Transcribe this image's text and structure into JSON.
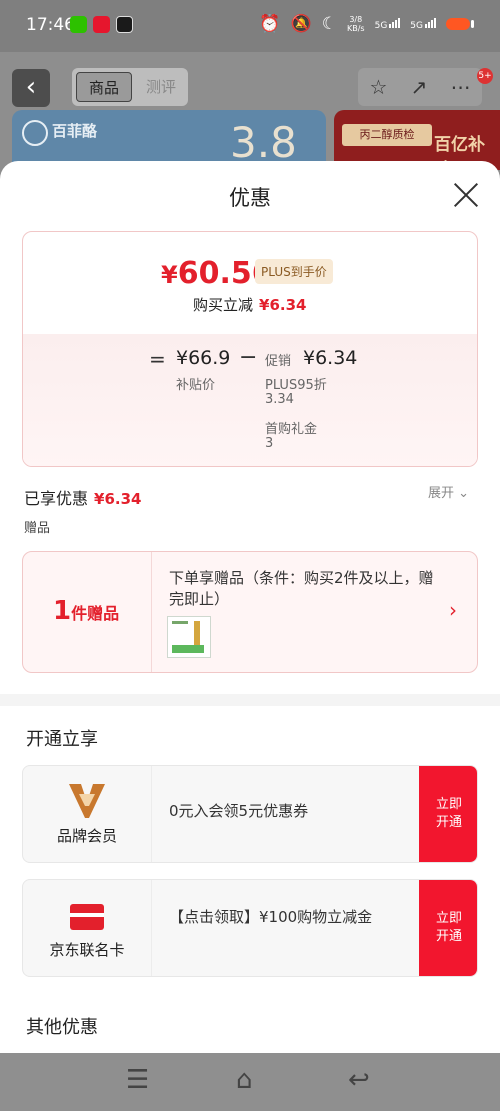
{
  "status_bar": {
    "time": "17:46",
    "net_speed_top": "3/8",
    "net_speed_bottom": "KB/s",
    "sig1": "5G",
    "sig2": "5G"
  },
  "header": {
    "tab_active": "商品",
    "tab_inactive": "测评",
    "badge": "5+"
  },
  "banners": {
    "left_brand": "百菲酪",
    "left_big": "3.8",
    "right_tag": "丙二醇质检",
    "right_text": "百亿补贴"
  },
  "sheet": {
    "title": "优惠",
    "price": {
      "symbol": "¥",
      "amount": "60.56",
      "plus_tag": "PLUS到手价",
      "buy_label": "购买立减",
      "buy_amount": "¥6.34"
    },
    "breakdown": {
      "equals": "=",
      "subsidy_price": "¥66.9",
      "subsidy_label": "补贴价",
      "minus": "−",
      "promo_label": "促销",
      "promo_amount": "¥6.34",
      "plus95_label": "PLUS95折",
      "plus95_value": "3.34",
      "first_gift_label": "首购礼金",
      "first_gift_value": "3"
    },
    "enjoyed_label": "已享优惠",
    "enjoyed_amount": "¥6.34",
    "expand_label": "展开",
    "gift_section_label": "赠品",
    "gift": {
      "count": "1",
      "count_suffix": "件赠品",
      "desc": "下单享赠品（条件：购买2件及以上，赠完即止）"
    },
    "open_section_title": "开通立享",
    "members": [
      {
        "title": "品牌会员",
        "desc": "0元入会领5元优惠券",
        "button": "立即开通"
      },
      {
        "title": "京东联名卡",
        "desc": "【点击领取】¥100购物立减金",
        "button": "立即开通"
      }
    ],
    "other_section_title": "其他优惠"
  },
  "colors": {
    "accent_red": "#e3202c",
    "button_red": "#f2162e",
    "plus_tag_bg": "#f8ead6"
  }
}
